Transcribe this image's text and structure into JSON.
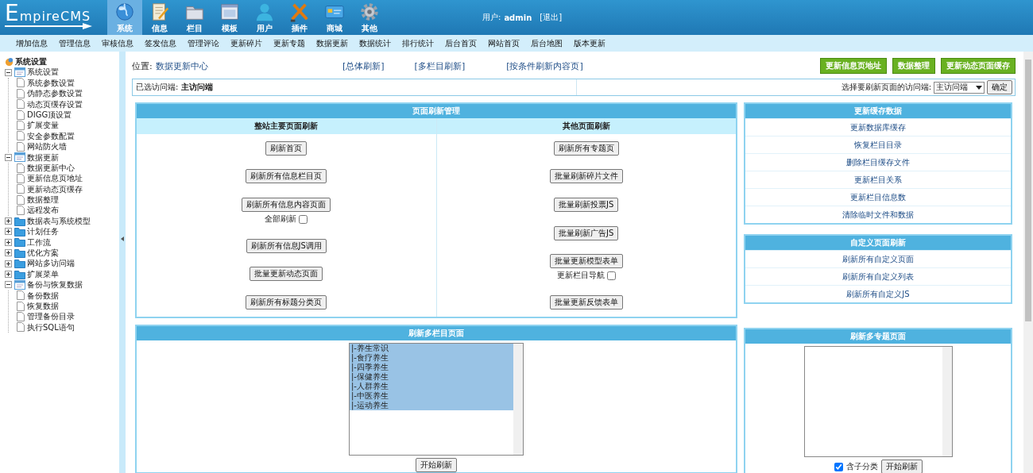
{
  "header": {
    "logo": "EmpireCMS",
    "nav": [
      {
        "label": "系统",
        "selected": true
      },
      {
        "label": "信息",
        "selected": false
      },
      {
        "label": "栏目",
        "selected": false
      },
      {
        "label": "模板",
        "selected": false
      },
      {
        "label": "用户",
        "selected": false
      },
      {
        "label": "插件",
        "selected": false
      },
      {
        "label": "商城",
        "selected": false
      },
      {
        "label": "其他",
        "selected": false
      }
    ],
    "user_label": "用户:",
    "user_name": "admin",
    "logout": "[退出]"
  },
  "menu_bar": [
    "增加信息",
    "管理信息",
    "审核信息",
    "签发信息",
    "管理评论",
    "更新碎片",
    "更新专题",
    "数据更新",
    "数据统计",
    "排行统计",
    "后台首页",
    "网站首页",
    "后台地图",
    "版本更新"
  ],
  "sidebar": {
    "title": "系统设置",
    "groups": [
      {
        "label": "系统设置",
        "expanded": true,
        "children": [
          "系统参数设置",
          "伪静态参数设置",
          "动态页缓存设置",
          "DIGG顶设置",
          "扩展变量",
          "安全参数配置",
          "网站防火墙"
        ]
      },
      {
        "label": "数据更新",
        "expanded": true,
        "children": [
          "数据更新中心",
          "更新信息页地址",
          "更新动态页缓存",
          "数据整理",
          "远程发布"
        ]
      },
      {
        "label": "数据表与系统模型",
        "expanded": false
      },
      {
        "label": "计划任务",
        "expanded": false
      },
      {
        "label": "工作流",
        "expanded": false
      },
      {
        "label": "优化方案",
        "expanded": false
      },
      {
        "label": "网站多访问端",
        "expanded": false
      },
      {
        "label": "扩展菜单",
        "expanded": false
      },
      {
        "label": "备份与恢复数据",
        "expanded": true,
        "children": [
          "备份数据",
          "恢复数据",
          "管理备份目录",
          "执行SQL语句"
        ]
      }
    ]
  },
  "location": {
    "label": "位置:",
    "page": "数据更新中心"
  },
  "links": [
    "[总体刷新]",
    "[多栏目刷新]",
    "[按条件刷新内容页]"
  ],
  "actions": [
    "更新信息页地址",
    "数据整理",
    "更新动态页面缓存"
  ],
  "access_bar": {
    "label": "已选访问端:",
    "value": "主访问端",
    "select_label": "选择要刷新页面的访问端:",
    "select_value": "主访问端",
    "confirm": "确定"
  },
  "refresh_panel": {
    "title": "页面刷新管理",
    "columns": [
      {
        "heading": "整站主要页面刷新",
        "items": [
          {
            "label": "刷新首页"
          },
          {
            "label": "刷新所有信息栏目页"
          },
          {
            "label": "刷新所有信息内容页面",
            "option": {
              "label": "全部刷新",
              "checked": false
            }
          },
          {
            "label": "刷新所有信息JS调用"
          },
          {
            "label": "批量更新动态页面"
          },
          {
            "label": "刷新所有标题分类页"
          }
        ]
      },
      {
        "heading": "其他页面刷新",
        "items": [
          {
            "label": "刷新所有专题页"
          },
          {
            "label": "批量刷新碎片文件"
          },
          {
            "label": "批量刷新投票JS"
          },
          {
            "label": "批量刷新广告JS"
          },
          {
            "label": "批量更新模型表单",
            "option": {
              "label": "更新栏目导航",
              "checked": false
            }
          },
          {
            "label": "批量更新反馈表单"
          }
        ]
      }
    ]
  },
  "multi_column": {
    "title": "刷新多栏目页面",
    "options": [
      {
        "label": "|-养生常识",
        "selected": true
      },
      {
        "label": "|-食疗养生",
        "selected": true
      },
      {
        "label": "|-四季养生",
        "selected": true
      },
      {
        "label": "|-保健养生",
        "selected": true
      },
      {
        "label": "|-人群养生",
        "selected": true
      },
      {
        "label": "|-中医养生",
        "selected": true
      },
      {
        "label": "|-运动养生",
        "selected": true
      }
    ],
    "button": "开始刷新"
  },
  "cache_panel": {
    "title": "更新缓存数据",
    "links": [
      "更新数据库缓存",
      "恢复栏目目录",
      "删除栏目缓存文件",
      "更新栏目关系",
      "更新栏目信息数",
      "清除临时文件和数据"
    ]
  },
  "custom_panel": {
    "title": "自定义页面刷新",
    "links": [
      "刷新所有自定义页面",
      "刷新所有自定义列表",
      "刷新所有自定义JS"
    ]
  },
  "multi_topic": {
    "title": "刷新多专题页面",
    "include_children": {
      "label": "含子分类",
      "checked": true
    },
    "button": "开始刷新"
  }
}
